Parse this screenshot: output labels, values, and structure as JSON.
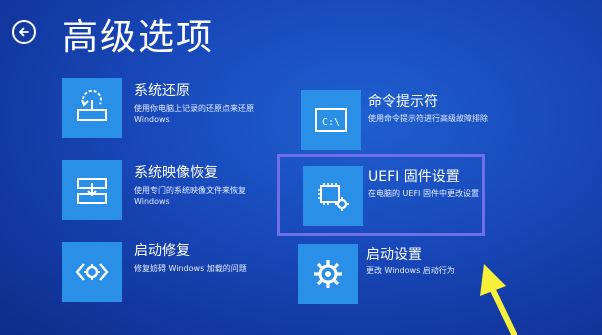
{
  "header": {
    "title": "高级选项"
  },
  "options": [
    {
      "title": "系统还原",
      "desc1": "使用你电脑上记录的还原点来还原",
      "desc2": "Windows",
      "icon": "system-restore-icon"
    },
    {
      "title": "系统映像恢复",
      "desc1": "使用专门的系统映像文件来恢复",
      "desc2": "Windows",
      "icon": "system-image-icon"
    },
    {
      "title": "启动修复",
      "desc1": "修复妨碍 Windows 加载的问题",
      "icon": "startup-repair-icon"
    },
    {
      "title": "命令提示符",
      "desc1": "使用命令提示符进行高级故障排除",
      "icon": "command-prompt-icon"
    },
    {
      "title": "UEFI 固件设置",
      "desc1": "在电脑的 UEFI 固件中更改设置",
      "icon": "firmware-chip-icon"
    },
    {
      "title": "启动设置",
      "desc1": "更改 Windows 启动行为",
      "icon": "gear-icon"
    }
  ],
  "annotation": {
    "highlight_color": "#6f6fe8",
    "arrow_color": "#f7f03a"
  },
  "colors": {
    "background": "#1847b8",
    "tile": "#2a8fe6"
  }
}
